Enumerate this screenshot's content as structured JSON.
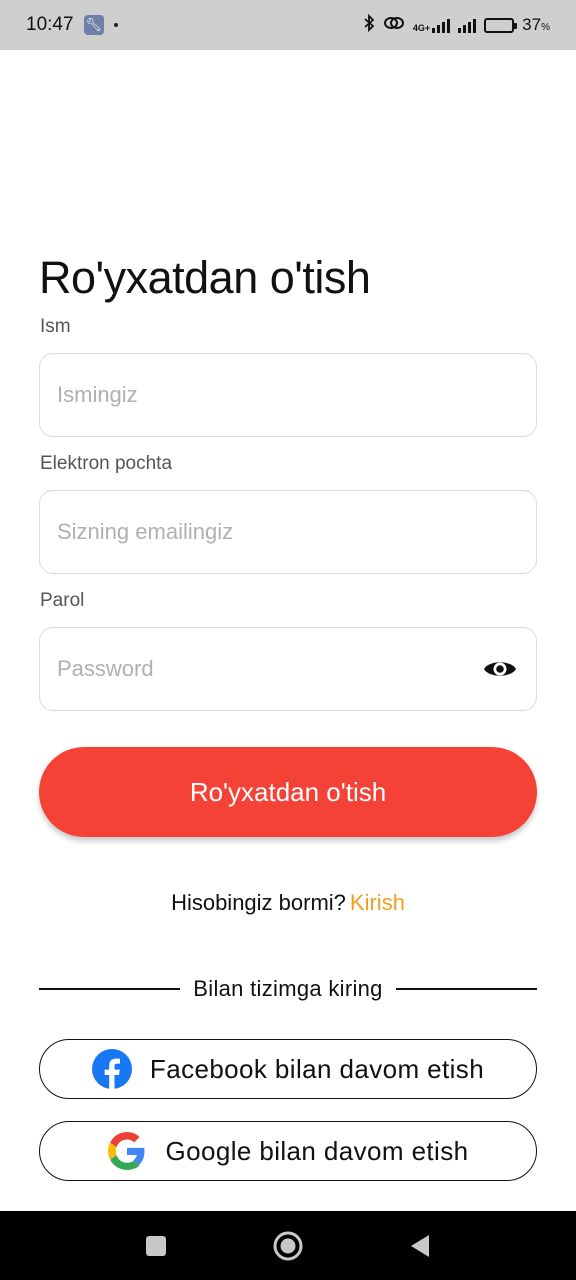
{
  "status_bar": {
    "time": "10:47",
    "network_label": "4G+",
    "battery_percent": "37",
    "battery_unit": "%",
    "battery_level": 0.37
  },
  "page": {
    "title": "Ro'yxatdan o'tish"
  },
  "form": {
    "name": {
      "label": "Ism",
      "placeholder": "Ismingiz",
      "value": ""
    },
    "email": {
      "label": "Elektron pochta",
      "placeholder": "Sizning emailingiz",
      "value": ""
    },
    "password": {
      "label": "Parol",
      "placeholder": "Password",
      "value": ""
    },
    "submit_label": "Ro'yxatdan o'tish"
  },
  "login": {
    "prompt": "Hisobingiz bormi?",
    "link": "Kirish"
  },
  "social": {
    "divider_text": "Bilan tizimga kiring",
    "facebook_label": "Facebook bilan davom etish",
    "google_label": "Google bilan davom etish"
  },
  "colors": {
    "primary": "#f44336",
    "link": "#f0a020",
    "facebook": "#1877f2"
  },
  "icons": {
    "status": [
      "wrench-icon",
      "bluetooth-icon",
      "hotspot-icon",
      "signal-icon",
      "battery-charging-icon"
    ],
    "password_toggle": "eye-icon",
    "social": [
      "facebook-icon",
      "google-icon"
    ],
    "nav": [
      "recents-square-icon",
      "home-circle-icon",
      "back-triangle-icon"
    ]
  }
}
